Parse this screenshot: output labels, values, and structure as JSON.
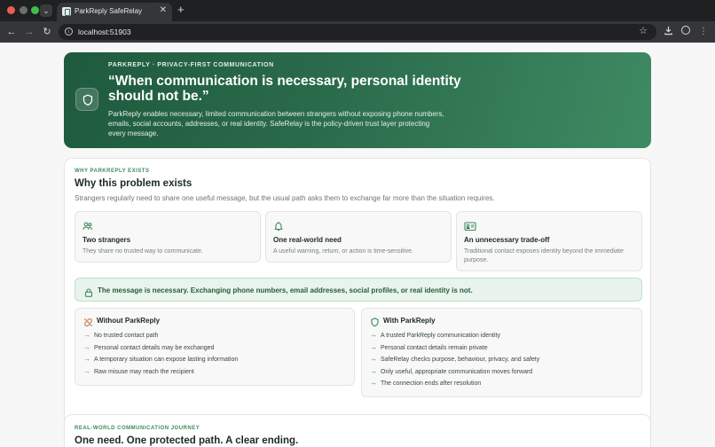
{
  "browser": {
    "tab_title": "ParkReply SafeRelay",
    "tab_close": "✕",
    "new_tab": "+",
    "url": "localhost:51903"
  },
  "hero": {
    "eyebrow": "PARKREPLY · PRIVACY-FIRST COMMUNICATION",
    "quote": "“When communication is necessary, personal identity should not be.”",
    "body": "ParkReply enables necessary, limited communication between strangers without exposing phone numbers, emails, social accounts, addresses, or real identity. SafeRelay is the policy-driven trust layer protecting every message."
  },
  "why": {
    "eyebrow": "WHY PARKREPLY EXISTS",
    "title": "Why this problem exists",
    "subtitle": "Strangers regularly need to share one useful message, but the usual path asks them to exchange far more than the situation requires.",
    "facts": [
      {
        "icon": "people-icon",
        "title": "Two strangers",
        "desc": "They share no trusted way to communicate."
      },
      {
        "icon": "bell-icon",
        "title": "One real-world need",
        "desc": "A useful warning, return, or action is time-sensitive."
      },
      {
        "icon": "id-card-icon",
        "title": "An unnecessary trade-off",
        "desc": "Traditional contact exposes identity beyond the immediate purpose."
      }
    ],
    "banner": "The message is necessary. Exchanging phone numbers, email addresses, social profiles, or real identity is not.",
    "without": {
      "title": "Without ParkReply",
      "items": [
        "No trusted contact path",
        "Personal contact details may be exchanged",
        "A temporary situation can expose lasting information",
        "Raw misuse may reach the recipient"
      ]
    },
    "with": {
      "title": "With ParkReply",
      "items": [
        "A trusted ParkReply communication identity",
        "Personal contact details remain private",
        "SafeRelay checks purpose, behaviour, privacy, and safety",
        "Only useful, appropriate communication moves forward",
        "The connection ends after resolution"
      ]
    }
  },
  "journey": {
    "eyebrow": "REAL-WORLD COMMUNICATION JOURNEY",
    "title": "One need. One protected path. A clear ending."
  },
  "colors": {
    "accent": "#3f8a5d",
    "hero_start": "#1f5a3e",
    "hero_end": "#3f8a63",
    "warning_arrow": "#c2703f"
  }
}
